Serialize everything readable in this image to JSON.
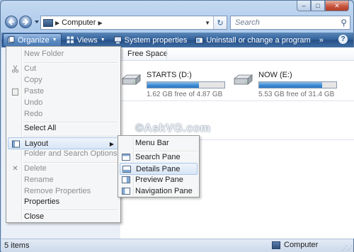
{
  "window": {
    "caption_minimize": "–",
    "caption_maximize": "□",
    "caption_close": "✕"
  },
  "nav": {
    "back_icon": "back-arrow-icon",
    "forward_icon": "forward-arrow-icon",
    "address_text": "Computer",
    "address_separator": "▶",
    "address_dropdown": "▼",
    "refresh_glyph": "↻",
    "search_placeholder": "Search",
    "search_glyph": "⚲"
  },
  "toolbar": {
    "organize": "Organize",
    "views": "Views",
    "system_properties": "System properties",
    "uninstall": "Uninstall or change a program",
    "more": "»",
    "help": "?"
  },
  "columns": {
    "free_space": "Free Space"
  },
  "drives": [
    {
      "name": "STARTS (D:)",
      "free_text": "1.62 GB free of 4.87 GB",
      "used_fraction": 0.67
    },
    {
      "name": "NOW (E:)",
      "free_text": "5.53 GB free of 31.4 GB",
      "used_fraction": 0.82
    }
  ],
  "watermark": "©AskVG.com",
  "status": {
    "items": "5 items",
    "location": "Computer"
  },
  "menu": {
    "new_folder": "New Folder",
    "cut": "Cut",
    "copy": "Copy",
    "paste": "Paste",
    "undo": "Undo",
    "redo": "Redo",
    "select_all": "Select All",
    "layout": "Layout",
    "folder_search_options": "Folder and Search Options",
    "delete": "Delete",
    "rename": "Rename",
    "remove_properties": "Remove Properties",
    "properties": "Properties",
    "close": "Close",
    "submenu_arrow": "▶",
    "delete_glyph": "✕"
  },
  "layout_submenu": {
    "menu_bar": "Menu Bar",
    "search_pane": "Search Pane",
    "details_pane": "Details Pane",
    "preview_pane": "Preview Pane",
    "navigation_pane": "Navigation Pane"
  },
  "colors": {
    "toolbar": "#2f5f99",
    "bar_fill": "#3f8ad4",
    "menu_highlight": "#d8e6f6"
  }
}
